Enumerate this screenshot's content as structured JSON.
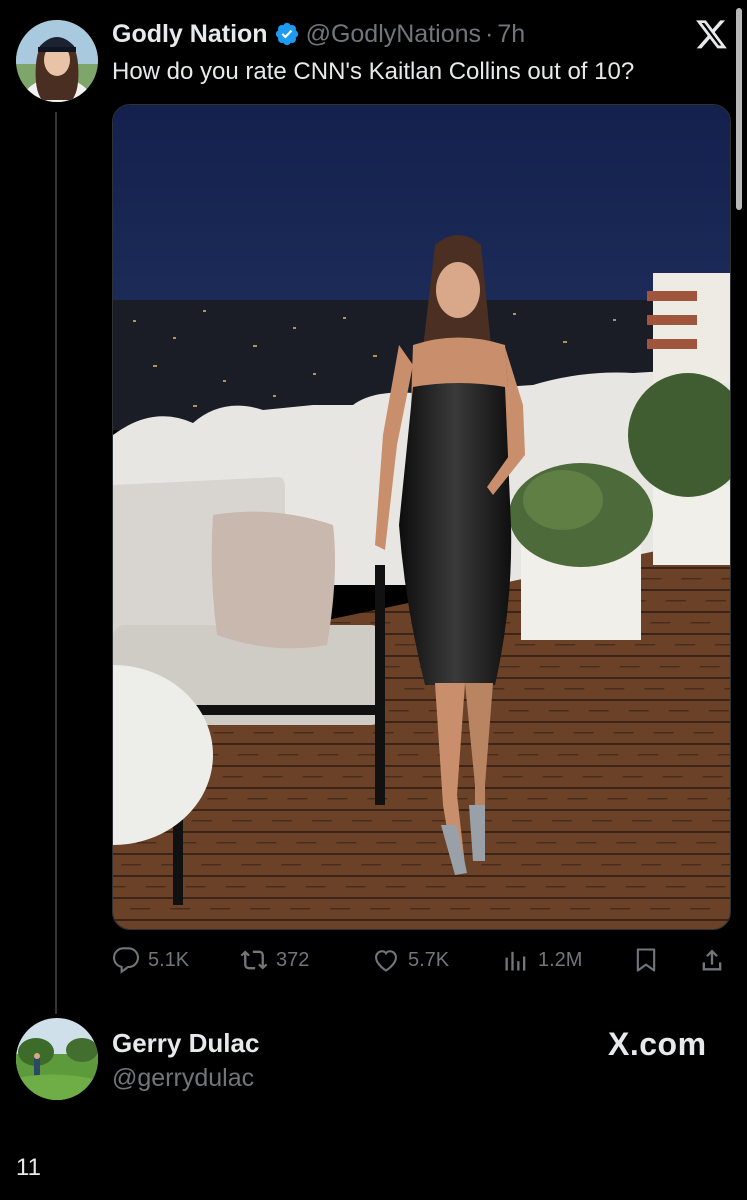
{
  "tweet": {
    "author_name": "Godly Nation",
    "author_handle": "@GodlyNations",
    "time": "7h",
    "separator": "·",
    "text": "How do you rate CNN's Kaitlan Collins out of 10?",
    "platform_icon": "x-logo-icon",
    "media_icon": "photo-image",
    "metrics": {
      "replies": "5.1K",
      "reposts": "372",
      "likes": "5.7K",
      "views": "1.2M"
    }
  },
  "reply": {
    "author_name": "Gerry Dulac",
    "author_handle": "@gerrydulac",
    "site_label": "X.com"
  },
  "footer": {
    "number": "11"
  },
  "colors": {
    "background": "#000000",
    "text_primary": "#e7e9ea",
    "text_secondary": "#71767b",
    "verified_blue": "#1d9bf0",
    "thread_line": "#333639"
  }
}
